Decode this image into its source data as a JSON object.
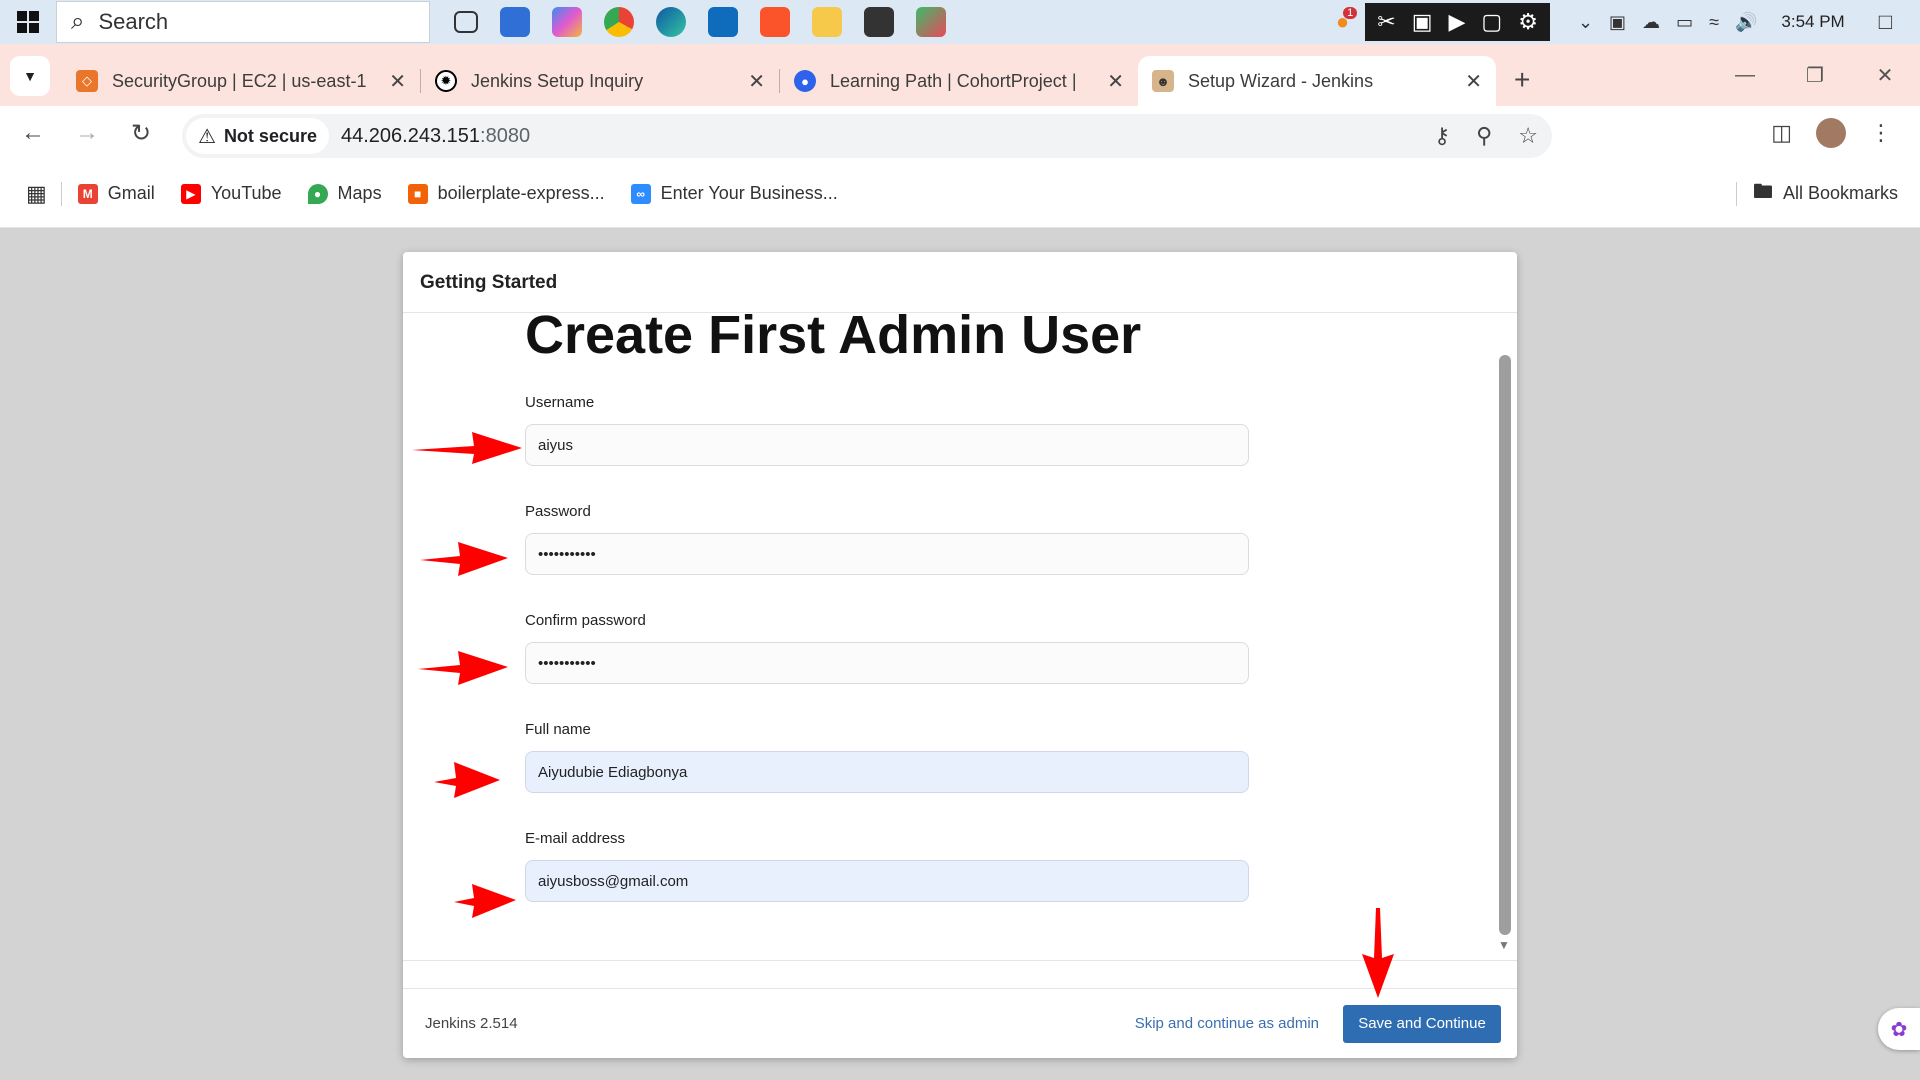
{
  "taskbar": {
    "search_placeholder": "Search",
    "clock": "3:54 PM",
    "notification_count": "1"
  },
  "tabs": [
    {
      "title": "SecurityGroup | EC2 | us-east-1",
      "active": false
    },
    {
      "title": "Jenkins Setup Inquiry",
      "active": false
    },
    {
      "title": "Learning Path | CohortProject |",
      "active": false
    },
    {
      "title": "Setup Wizard - Jenkins",
      "active": true
    }
  ],
  "address": {
    "security": "Not secure",
    "host": "44.206.243.151",
    "port": ":8080"
  },
  "bookmarks": [
    {
      "label": "Gmail",
      "icon": "gmail-icon",
      "color": "#ea4335"
    },
    {
      "label": "YouTube",
      "icon": "youtube-icon",
      "color": "#ff0000"
    },
    {
      "label": "Maps",
      "icon": "maps-icon",
      "color": "#34a853"
    },
    {
      "label": "boilerplate-express...",
      "icon": "replit-icon",
      "color": "#f26207"
    },
    {
      "label": "Enter Your Business...",
      "icon": "business-icon",
      "color": "#2d8cff"
    }
  ],
  "all_bookmarks": "All Bookmarks",
  "dialog": {
    "header": "Getting Started",
    "title": "Create First Admin User",
    "fields": {
      "username": {
        "label": "Username",
        "value": "aiyus"
      },
      "password": {
        "label": "Password",
        "value": "•••••••••••"
      },
      "confirm": {
        "label": "Confirm password",
        "value": "•••••••••••"
      },
      "fullname": {
        "label": "Full name",
        "value": "Aiyudubie Ediagbonya"
      },
      "email": {
        "label": "E-mail address",
        "value": "aiyusboss@gmail.com"
      }
    },
    "footer": {
      "version": "Jenkins 2.514",
      "skip": "Skip and continue as admin",
      "save": "Save and Continue"
    }
  },
  "colors": {
    "accent": "#2e6db1",
    "annotation": "#ff0000",
    "tabstrip": "#fde3de"
  }
}
